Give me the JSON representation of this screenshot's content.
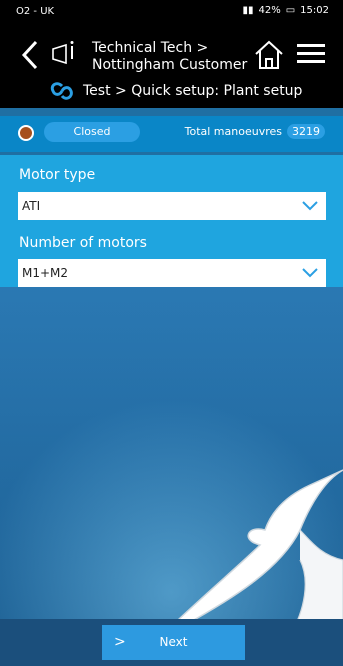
{
  "status_bar": {
    "carrier": "O2 - UK",
    "battery": "42%",
    "time": "15:02"
  },
  "header": {
    "breadcrumb_line1": "Technical Tech >",
    "breadcrumb_line2": "Nottingham Customer",
    "subtitle": "Test > Quick setup: Plant setup"
  },
  "device_status": {
    "state": "Closed",
    "state_color": "#a64f1d",
    "manoeuvres_label": "Total manoeuvres",
    "manoeuvres_count": "3219"
  },
  "fields": {
    "motor_type_label": "Motor type",
    "motor_type_value": "ATI",
    "motors_label": "Number of motors",
    "motors_value": "M1+M2"
  },
  "footer": {
    "next_arrow": ">",
    "next_label": "Next"
  },
  "colors": {
    "accent": "#2d9ae0",
    "panel": "#1fa5df",
    "topbar": "#000000"
  }
}
